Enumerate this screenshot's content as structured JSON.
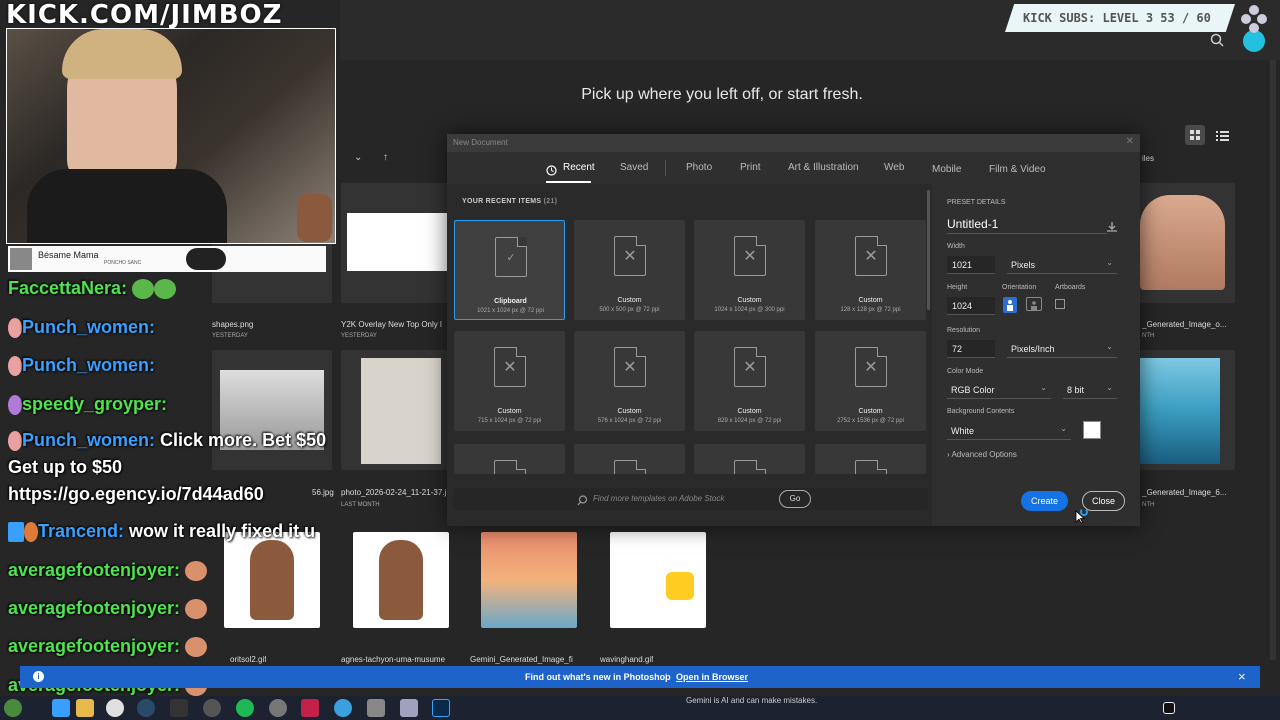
{
  "stream": {
    "banner": "KICK.COM/JIMBOZ",
    "subs_goal": "KICK SUBS: LEVEL 3 53 / 60",
    "now_playing_title": "Bésame Mama",
    "now_playing_artist": "PONCHO SANC"
  },
  "chat": [
    {
      "user": "FaccettaNera:",
      "color": "green",
      "msg": ""
    },
    {
      "user": "Punch_women:",
      "color": "blue",
      "msg": ""
    },
    {
      "user": "Punch_women:",
      "color": "blue",
      "msg": ""
    },
    {
      "user": "speedy_groyper:",
      "color": "green",
      "msg": ""
    },
    {
      "user": "Punch_women:",
      "color": "blue",
      "msg": "Click more. Bet $50"
    },
    {
      "user": "",
      "color": "white",
      "msg": "Get up to $50"
    },
    {
      "user": "",
      "color": "white",
      "msg": "https://go.egency.io/7d44ad60"
    },
    {
      "user": "Trancend:",
      "color": "blue",
      "msg": "wow it really fixed it u"
    },
    {
      "user": "averagefootenjoyer:",
      "color": "green",
      "msg": ""
    },
    {
      "user": "averagefootenjoyer:",
      "color": "green",
      "msg": ""
    },
    {
      "user": "averagefootenjoyer:",
      "color": "green",
      "msg": ""
    },
    {
      "user": "averagefootenjoyer:",
      "color": "green",
      "msg": ""
    }
  ],
  "home": {
    "hero": "Pick up where you left off, or start fresh.",
    "files": [
      {
        "name": "shapes.png",
        "sub": "YESTERDAY"
      },
      {
        "name": "Y2K Overlay New Top Only l",
        "sub": "YESTERDAY"
      },
      {
        "name": "56.jpg",
        "sub": ""
      },
      {
        "name": "photo_2026-02-24_11-21-37.j",
        "sub": "LAST MONTH"
      },
      {
        "name": "_Generated_Image_o...",
        "sub": "NTH"
      },
      {
        "name": "_Generated_Image_6...",
        "sub": "NTH"
      },
      {
        "name": "oritsol2.gif",
        "sub": ""
      },
      {
        "name": "agnes-tachyon-uma-musume",
        "sub": ""
      },
      {
        "name": "Gemini_Generated_Image_fi",
        "sub": ""
      },
      {
        "name": "wavinghand.gif",
        "sub": ""
      }
    ],
    "sort_label": "iles"
  },
  "dialog": {
    "title": "New Document",
    "tabs": [
      "Recent",
      "Saved",
      "Photo",
      "Print",
      "Art & Illustration",
      "Web",
      "Mobile",
      "Film & Video"
    ],
    "recent_heading": "YOUR RECENT ITEMS",
    "recent_count": "(21)",
    "presets": [
      {
        "name": "Clipboard",
        "dims": "1021 x 1024 px @ 72 ppi"
      },
      {
        "name": "Custom",
        "dims": "500 x 500 px @ 72 ppi"
      },
      {
        "name": "Custom",
        "dims": "1024 x 1024 px @ 300 ppi"
      },
      {
        "name": "Custom",
        "dims": "128 x 128 px @ 72 ppi"
      },
      {
        "name": "Custom",
        "dims": "715 x 1024 px @ 72 ppi"
      },
      {
        "name": "Custom",
        "dims": "576 x 1024 px @ 72 ppi"
      },
      {
        "name": "Custom",
        "dims": "829 x 1024 px @ 72 ppi"
      },
      {
        "name": "Custom",
        "dims": "2752 x 1536 px @ 72 ppi"
      }
    ],
    "search_placeholder": "Find more templates on Adobe Stock",
    "go_label": "Go",
    "details": {
      "heading": "PRESET DETAILS",
      "doc_name": "Untitled-1",
      "width_label": "Width",
      "width": "1021",
      "width_unit": "Pixels",
      "height_label": "Height",
      "height": "1024",
      "orientation_label": "Orientation",
      "artboards_label": "Artboards",
      "resolution_label": "Resolution",
      "resolution": "72",
      "resolution_unit": "Pixels/Inch",
      "color_mode_label": "Color Mode",
      "color_mode": "RGB Color",
      "bit_depth": "8 bit",
      "bg_label": "Background Contents",
      "bg": "White",
      "advanced": "Advanced Options"
    },
    "create_label": "Create",
    "close_label": "Close"
  },
  "banner": {
    "text": "Find out what's new in Photoshop",
    "link": "Open in Browser",
    "separator": "|",
    "close": "×"
  },
  "gemini_note": "Gemini is AI and can make mistakes.",
  "colors": {
    "accent": "#1473e6",
    "selected": "#2d9bf0",
    "banner": "#1e63c9"
  }
}
